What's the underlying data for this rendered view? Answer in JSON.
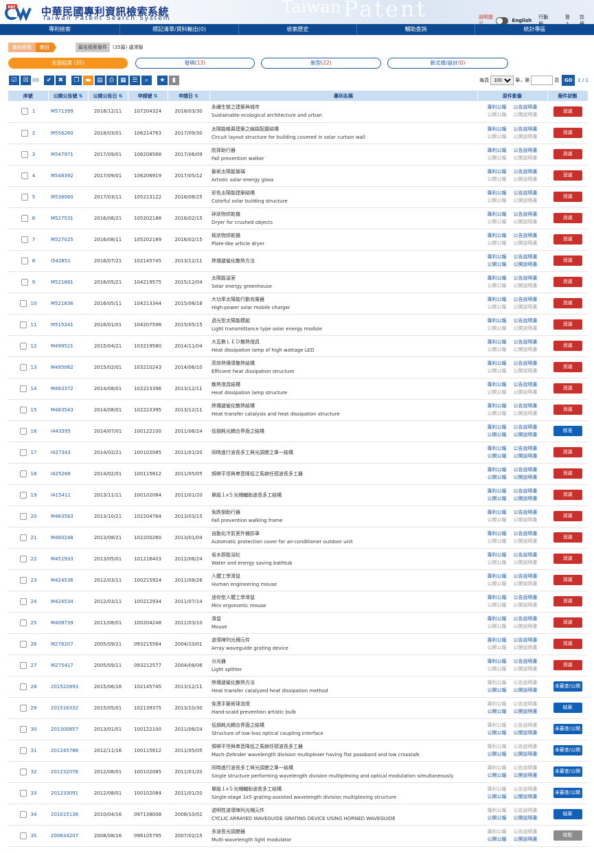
{
  "header": {
    "logo_badge": "PAT",
    "logo_zh": "中華民國專利資訊檢索系統",
    "logo_en": "Taiwan Patent Search System",
    "watermark1": "Taiwan",
    "watermark2": "Patent",
    "hint": "說明提示",
    "english": "English",
    "mobile": "行動版",
    "login": "登入",
    "register": "註冊"
  },
  "nav": [
    "專利檢索",
    "標記清單/資料輸出(0)",
    "檢索歷史",
    "輔助查詢",
    "統計專區"
  ],
  "breadcrumb": {
    "a": "專利檢索",
    "b": "簡目",
    "c": "篇名檢索條件",
    "d": "(35篇) 盧鴻智"
  },
  "tabs": [
    {
      "label": "全部結果 ",
      "count": "(35)"
    },
    {
      "label": "發明",
      "count": "(13)"
    },
    {
      "label": "新型",
      "count": "(22)"
    },
    {
      "label": "新式樣/設計",
      "count": "(0)"
    }
  ],
  "toolbar": {
    "selected": "(0)"
  },
  "pager": {
    "per_page_label": "每頁",
    "per_page": "100",
    "unit": "筆，第",
    "page_unit": "頁",
    "go": "GO",
    "pages": "1 / 1"
  },
  "columns": [
    "序號",
    "公開公告號",
    "公開公告日",
    "申請號",
    "申請日",
    "專利名稱",
    "原件影像",
    "案件狀態"
  ],
  "links": {
    "a": "專利公報",
    "b": "公告說明書",
    "c": "公開公報",
    "d": "公開說明書"
  },
  "status_colors": {
    "red": "#c9302c",
    "blue": "#1060b8",
    "gray": "#8c8c8c"
  },
  "rows": [
    {
      "no": "1",
      "pub": "M571399",
      "pub_date": "2018/12/11",
      "app": "107204324",
      "app_date": "2018/03/30",
      "zh": "永續生態之建築與城市",
      "en": "Sustainable ecological architecture and urban",
      "type": "A",
      "status": "消滅",
      "color": "red"
    },
    {
      "no": "2",
      "pub": "M556260",
      "pub_date": "2018/03/01",
      "app": "106214763",
      "app_date": "2017/09/30",
      "zh": "太陽能帷幕建築之線路配置結構",
      "en": "Circuit layout structure for building covered in solar curtain wall",
      "type": "A",
      "status": "消滅",
      "color": "red"
    },
    {
      "no": "3",
      "pub": "M547971",
      "pub_date": "2017/09/01",
      "app": "106208568",
      "app_date": "2017/06/09",
      "zh": "防摔助行器",
      "en": "Fall prevention walker",
      "type": "A",
      "status": "消滅",
      "color": "red"
    },
    {
      "no": "4",
      "pub": "M548392",
      "pub_date": "2017/09/01",
      "app": "106206919",
      "app_date": "2017/05/12",
      "zh": "藝術太陽能玻璃",
      "en": "Artistic solar energy glass",
      "type": "A",
      "status": "消滅",
      "color": "red"
    },
    {
      "no": "5",
      "pub": "M538060",
      "pub_date": "2017/03/11",
      "app": "105213122",
      "app_date": "2016/08/25",
      "zh": "彩色太陽能建築結構",
      "en": "Colorful solar building structure",
      "type": "A",
      "status": "消滅",
      "color": "red"
    },
    {
      "no": "6",
      "pub": "M527531",
      "pub_date": "2016/08/21",
      "app": "105202188",
      "app_date": "2016/02/15",
      "zh": "碎狀物烘乾機",
      "en": "Dryer for crushed objects",
      "type": "A",
      "status": "消滅",
      "color": "red"
    },
    {
      "no": "7",
      "pub": "M527025",
      "pub_date": "2016/08/11",
      "app": "105202189",
      "app_date": "2016/02/15",
      "zh": "板狀物烘乾機",
      "en": "Plate-like article dryer",
      "type": "A",
      "status": "消滅",
      "color": "red"
    },
    {
      "no": "8",
      "pub": "I542851",
      "pub_date": "2016/07/21",
      "app": "102145745",
      "app_date": "2013/12/11",
      "zh": "熱傳遞催化散熱方法",
      "en": "",
      "type": "B",
      "status": "消滅",
      "color": "red"
    },
    {
      "no": "9",
      "pub": "M521881",
      "pub_date": "2016/05/21",
      "app": "104219575",
      "app_date": "2015/12/04",
      "zh": "太陽能溫室",
      "en": "Solar energy greenhouse",
      "type": "A",
      "status": "消滅",
      "color": "red"
    },
    {
      "no": "10",
      "pub": "M521836",
      "pub_date": "2016/05/11",
      "app": "104213344",
      "app_date": "2015/08/18",
      "zh": "大功率太陽能行動充電器",
      "en": "High-power solar mobile charger",
      "type": "A",
      "status": "消滅",
      "color": "red"
    },
    {
      "no": "11",
      "pub": "M515241",
      "pub_date": "2016/01/01",
      "app": "104207598",
      "app_date": "2015/05/15",
      "zh": "透光型太陽能模組",
      "en": "Light transmittance type solar energy module",
      "type": "A",
      "status": "消滅",
      "color": "red"
    },
    {
      "no": "12",
      "pub": "M499521",
      "pub_date": "2015/04/21",
      "app": "103219580",
      "app_date": "2014/11/04",
      "zh": "大瓦數ＬＥＤ散熱燈具",
      "en": "Heat dissipation lamp of high wattage LED",
      "type": "A",
      "status": "消滅",
      "color": "red"
    },
    {
      "no": "13",
      "pub": "M495062",
      "pub_date": "2015/02/01",
      "app": "103210243",
      "app_date": "2014/06/10",
      "zh": "高效熱傳導散熱結構",
      "en": "Efficient heat dissipation structure",
      "type": "A",
      "status": "消滅",
      "color": "red"
    },
    {
      "no": "14",
      "pub": "M483372",
      "pub_date": "2014/08/01",
      "app": "102223396",
      "app_date": "2013/12/11",
      "zh": "散熱燈具結構",
      "en": "Heat dissipation lamp structure",
      "type": "A",
      "status": "消滅",
      "color": "red"
    },
    {
      "no": "15",
      "pub": "M483543",
      "pub_date": "2014/08/01",
      "app": "102223395",
      "app_date": "2013/12/11",
      "zh": "熱傳遞催化散熱結構",
      "en": "Heat transfer catalysis and heat dissipation structure",
      "type": "A",
      "status": "消滅",
      "color": "red"
    },
    {
      "no": "16",
      "pub": "I443395",
      "pub_date": "2014/07/01",
      "app": "100122100",
      "app_date": "2011/06/24",
      "zh": "低損耗光耦合界面之結構",
      "en": "",
      "type": "B",
      "status": "核准",
      "color": "blue"
    },
    {
      "no": "17",
      "pub": "I427343",
      "pub_date": "2014/02/21",
      "app": "100102085",
      "app_date": "2011/01/20",
      "zh": "同時進行波長多工與光調變之單一結構",
      "en": "",
      "type": "B",
      "status": "消滅",
      "color": "red"
    },
    {
      "no": "18",
      "pub": "I425266",
      "pub_date": "2014/02/01",
      "app": "100115812",
      "app_date": "2011/05/05",
      "zh": "頻帶平坦與串音降低之馬赫任德波長多工器",
      "en": "",
      "type": "B",
      "status": "消滅",
      "color": "red"
    },
    {
      "no": "19",
      "pub": "I415411",
      "pub_date": "2013/11/11",
      "app": "100102084",
      "app_date": "2011/01/20",
      "zh": "單級１x５光柵輔助波長多工結構",
      "en": "",
      "type": "B",
      "status": "消滅",
      "color": "red"
    },
    {
      "no": "20",
      "pub": "M463583",
      "pub_date": "2013/10/21",
      "app": "102204764",
      "app_date": "2013/03/15",
      "zh": "免跌倒助行器",
      "en": "Fall prevention walking frame",
      "type": "A",
      "status": "消滅",
      "color": "red"
    },
    {
      "no": "21",
      "pub": "M460248",
      "pub_date": "2013/08/21",
      "app": "102200260",
      "app_date": "2013/01/04",
      "zh": "自動化冷氣室外機防罩",
      "en": "Automatic protection cover for air-conditioner outdoor unit",
      "type": "A",
      "status": "消滅",
      "color": "red"
    },
    {
      "no": "22",
      "pub": "M451933",
      "pub_date": "2013/05/01",
      "app": "101216403",
      "app_date": "2012/08/24",
      "zh": "省水節能浴缸",
      "en": "Water and energy saving bathtub",
      "type": "A",
      "status": "消滅",
      "color": "red"
    },
    {
      "no": "23",
      "pub": "M424536",
      "pub_date": "2012/03/11",
      "app": "100215924",
      "app_date": "2011/08/26",
      "zh": "人體工學滑鼠",
      "en": "Human engineering mouse",
      "type": "A",
      "status": "消滅",
      "color": "red"
    },
    {
      "no": "24",
      "pub": "M424534",
      "pub_date": "2012/03/11",
      "app": "100212934",
      "app_date": "2011/07/14",
      "zh": "迷你型人體工學滑鼠",
      "en": "Mini ergonomic mouse",
      "type": "A",
      "status": "消滅",
      "color": "red"
    },
    {
      "no": "25",
      "pub": "M408739",
      "pub_date": "2011/08/01",
      "app": "100204248",
      "app_date": "2011/03/10",
      "zh": "滑鼠",
      "en": "Mouse",
      "type": "A",
      "status": "消滅",
      "color": "red"
    },
    {
      "no": "26",
      "pub": "M276207",
      "pub_date": "2005/09/21",
      "app": "093215564",
      "app_date": "2004/10/01",
      "zh": "波導陣列光柵元件",
      "en": "Array waveguide grating device",
      "type": "A",
      "status": "消滅",
      "color": "red"
    },
    {
      "no": "27",
      "pub": "M275417",
      "pub_date": "2005/09/11",
      "app": "093212577",
      "app_date": "2004/08/06",
      "zh": "分光器",
      "en": "Light splitter",
      "type": "A",
      "status": "消滅",
      "color": "red"
    },
    {
      "no": "28",
      "pub": "201522893",
      "pub_date": "2015/06/16",
      "app": "102145745",
      "app_date": "2013/12/11",
      "zh": "熱傳遞催化散熱方法",
      "en": "Heat transfer catalyzed heat dissipation method",
      "type": "C",
      "status": "未審查/公開",
      "color": "blue"
    },
    {
      "no": "29",
      "pub": "201516332",
      "pub_date": "2015/05/01",
      "app": "102139375",
      "app_date": "2013/10/30",
      "zh": "免燙手藝術球泡燈",
      "en": "Hand-scald prevention artistic bulb",
      "type": "C",
      "status": "結案",
      "color": "blue"
    },
    {
      "no": "30",
      "pub": "201300857",
      "pub_date": "2013/01/01",
      "app": "100122100",
      "app_date": "2011/06/24",
      "zh": "低損耗光耦合界面之結構",
      "en": "Structure of low-loss optical coupling interface",
      "type": "C",
      "status": "未審查/公開",
      "color": "blue"
    },
    {
      "no": "31",
      "pub": "201245788",
      "pub_date": "2012/11/16",
      "app": "100115812",
      "app_date": "2011/05/05",
      "zh": "頻帶平坦與串音降低之馬赫任德波長多工器",
      "en": "Mach-Zehnder wavelength division multiplexer having flat passband and low crosstalk",
      "type": "C",
      "status": "未審查/公開",
      "color": "blue"
    },
    {
      "no": "32",
      "pub": "201232076",
      "pub_date": "2012/08/01",
      "app": "100102085",
      "app_date": "2011/01/20",
      "zh": "同時進行波長多工與光調變之單一結構",
      "en": "Single structure performing wavelength division multiplexing and optical modulation simultaneously",
      "type": "C",
      "status": "未審查/公開",
      "color": "blue"
    },
    {
      "no": "33",
      "pub": "201233091",
      "pub_date": "2012/08/01",
      "app": "100102084",
      "app_date": "2011/01/20",
      "zh": "單級１x５光柵輔助波長多工結構",
      "en": "Single-stage 1x5 grating-assisted wavelength division multiplexing structure",
      "type": "C",
      "status": "未審查/公開",
      "color": "blue"
    },
    {
      "no": "34",
      "pub": "201015136",
      "pub_date": "2010/04/16",
      "app": "097138008",
      "app_date": "2008/10/02",
      "zh": "透明性波導陣列光柵元件",
      "en": "CYCLIC ARRAYED WAVEGUIDE GRATING DEVICE USING HORNED WAVEGUIDE",
      "type": "C",
      "status": "結案",
      "color": "blue"
    },
    {
      "no": "35",
      "pub": "200834207",
      "pub_date": "2008/08/16",
      "app": "096105795",
      "app_date": "2007/02/15",
      "zh": "多波長光調變器",
      "en": "Multi-wavelength light modulator",
      "type": "C",
      "status": "核駁",
      "color": "gray"
    }
  ]
}
